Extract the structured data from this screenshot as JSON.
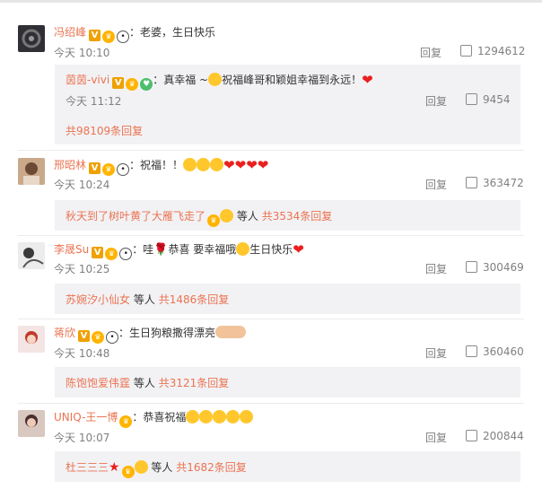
{
  "comments": [
    {
      "username": "冯绍峰",
      "text": "：老婆，生日快乐",
      "time": "今天 10:10",
      "reply_label": "回复",
      "likes": "1294612",
      "subreply": {
        "username": "茵茵-vivi",
        "text": "：真幸福 ~",
        "text2": "祝福峰哥和颖姐幸福到永远！",
        "time": "今天 11:12",
        "reply_label": "回复",
        "likes": "9454"
      },
      "more": "共98109条回复"
    },
    {
      "username": "邢昭林",
      "text": "：祝福！！",
      "time": "今天 10:24",
      "reply_label": "回复",
      "likes": "363472",
      "sub_user": "秋天到了树叶黄了大雁飞走了",
      "sub_mid": "等人",
      "sub_count": "共3534条回复"
    },
    {
      "username": "李晟Su",
      "text": "：哇",
      "text2": "恭喜    要幸福哦",
      "text3": "生日快乐",
      "time": "今天 10:25",
      "reply_label": "回复",
      "likes": "300469",
      "sub_user": "苏婉汐小仙女",
      "sub_mid": "等人",
      "sub_count": "共1486条回复"
    },
    {
      "username": "蒋欣",
      "text": "：生日狗粮撒得漂亮",
      "time": "今天 10:48",
      "reply_label": "回复",
      "likes": "360460",
      "sub_user": "陈饱饱爱伟霆",
      "sub_mid": "等人",
      "sub_count": "共3121条回复"
    },
    {
      "username": "UNIQ-王一博",
      "text": "：恭喜祝福",
      "time": "今天 10:07",
      "reply_label": "回复",
      "likes": "200844",
      "sub_user": "杜三三三",
      "sub_mid": "等人",
      "sub_count": "共1682条回复"
    }
  ],
  "colors": {
    "accent": "#eb7350",
    "subbg": "#f2f2f5",
    "heart": "#e9201f"
  },
  "icons": [
    "vip-badge-icon",
    "crown-icon",
    "panda-icon",
    "heart-icon",
    "face-emoji-icon",
    "thumb-up-icon",
    "rose-icon",
    "star-icon"
  ]
}
